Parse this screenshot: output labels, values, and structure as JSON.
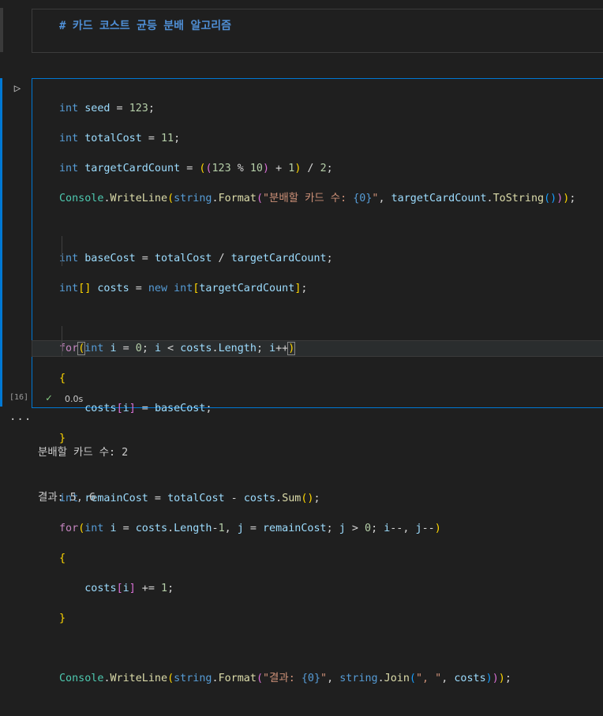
{
  "markdown_cell": {
    "text": "# 카드 코스트 균등 분배 알고리즘"
  },
  "code_cell": {
    "execution_count": "[16]",
    "exec_time": "0.0s",
    "icons": {
      "run": "play-icon",
      "status": "check-icon",
      "output_menu": "ellipsis-icon"
    }
  },
  "output": {
    "lines": [
      "분배할 카드 수: 2",
      "결과: 5, 6"
    ]
  }
}
